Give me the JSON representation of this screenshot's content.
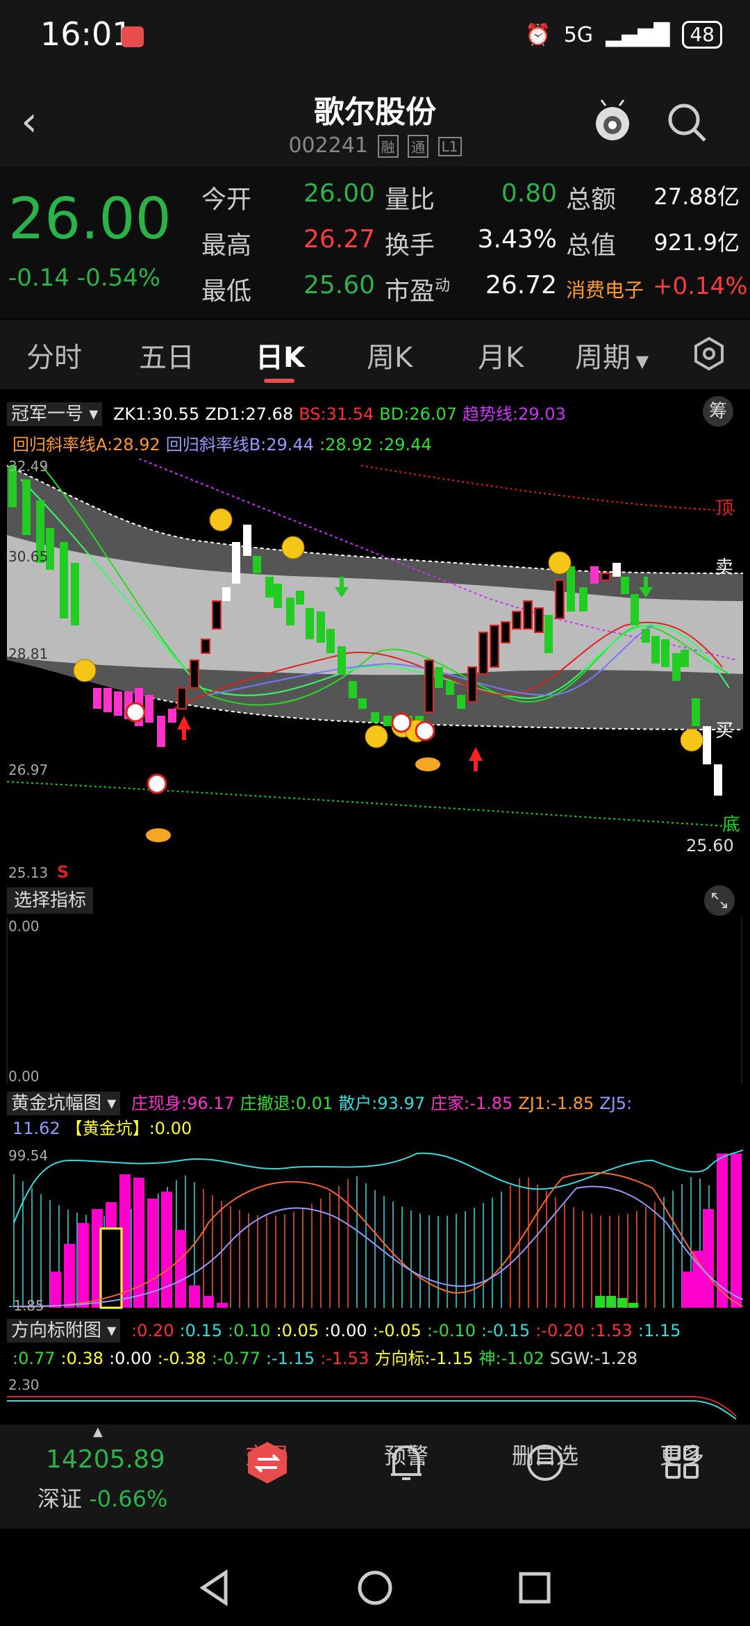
{
  "status": {
    "time": "16:01",
    "network": "5G",
    "battery": "48"
  },
  "header": {
    "name": "歌尔股份",
    "code": "002241",
    "tags": [
      "融",
      "通",
      "L1"
    ]
  },
  "quote": {
    "price": "26.00",
    "change": "-0.14",
    "change_pct": "-0.54%",
    "rows": [
      {
        "l1": "今开",
        "v1": "26.00",
        "l2": "量比",
        "v2": "0.80",
        "l3": "总额",
        "v3": "27.88亿"
      },
      {
        "l1": "最高",
        "v1": "26.27",
        "l2": "换手",
        "v2": "3.43%",
        "l3": "总值",
        "v3": "921.9亿"
      },
      {
        "l1": "最低",
        "v1": "25.60",
        "l2": "市盈",
        "l2sup": "动",
        "v2": "26.72",
        "l3": "消费电子",
        "v3": "+0.14%"
      }
    ]
  },
  "tabs": [
    "分时",
    "五日",
    "日K",
    "周K",
    "月K",
    "周期"
  ],
  "main_indicator": {
    "selector": "冠军一号",
    "line1": [
      {
        "t": "ZK1:30.55",
        "c": "#ffffff"
      },
      {
        "t": "ZD1:27.68",
        "c": "#ffffff"
      },
      {
        "t": "BS:31.54",
        "c": "#ff3030"
      },
      {
        "t": "BD:26.07",
        "c": "#33dd33"
      },
      {
        "t": "趋势线:29.03",
        "c": "#cc33ff"
      }
    ],
    "line2": [
      {
        "t": "回归斜率线A:28.92",
        "c": "#ff9933"
      },
      {
        "t": "回归斜率线B:29.44",
        "c": "#9999ff"
      },
      {
        "t": ":28.92",
        "c": "#33dd33"
      },
      {
        "t": ":29.44",
        "c": "#33dd33"
      }
    ],
    "chou_label": "筹",
    "axis": {
      "top": "32.49",
      "mid1": "30.65",
      "mid2": "28.81",
      "low": "26.97",
      "bottom": "25.13"
    },
    "labels": {
      "top_mark": "顶",
      "sell": "卖",
      "buy": "买",
      "bottom_mark": "底",
      "s_mark": "S",
      "last_price": "25.60"
    }
  },
  "sub1": {
    "selector": "选择指标",
    "top": "0.00",
    "bottom": "0.00"
  },
  "sub2": {
    "selector": "黄金坑幅图",
    "items": [
      {
        "t": "庄现身:96.17",
        "c": "#ff33cc"
      },
      {
        "t": "庄撤退:0.01",
        "c": "#33dd33"
      },
      {
        "t": "散户:93.97",
        "c": "#33dddd"
      },
      {
        "t": "庄家:-1.85",
        "c": "#ff33cc"
      },
      {
        "t": "ZJ1:-1.85",
        "c": "#ff9933"
      },
      {
        "t": "ZJ5:",
        "c": "#9999ff"
      }
    ],
    "line2": [
      {
        "t": "11.62",
        "c": "#9999ff"
      },
      {
        "t": "【黄金坑】:0.00",
        "c": "#ffff33"
      }
    ],
    "top": "99.54",
    "bottom": "-1.85"
  },
  "sub3": {
    "selector": "方向标附图",
    "line1": [
      {
        "t": ":0.20",
        "c": "#ff3030"
      },
      {
        "t": ":0.15",
        "c": "#33dddd"
      },
      {
        "t": ":0.10",
        "c": "#33dd33"
      },
      {
        "t": ":0.05",
        "c": "#ffff33"
      },
      {
        "t": ":0.00",
        "c": "#ffffff"
      },
      {
        "t": ":-0.05",
        "c": "#ffff33"
      },
      {
        "t": ":-0.10",
        "c": "#33dd33"
      },
      {
        "t": ":-0.15",
        "c": "#33dddd"
      },
      {
        "t": ":-0.20",
        "c": "#ff3030"
      },
      {
        "t": ":1.53",
        "c": "#ff3030"
      },
      {
        "t": ":1.15",
        "c": "#33dddd"
      }
    ],
    "line2": [
      {
        "t": ":0.77",
        "c": "#33dd33"
      },
      {
        "t": ":0.38",
        "c": "#ffff33"
      },
      {
        "t": ":0.00",
        "c": "#ffffff"
      },
      {
        "t": ":-0.38",
        "c": "#ffff33"
      },
      {
        "t": ":-0.77",
        "c": "#33dd33"
      },
      {
        "t": ":-1.15",
        "c": "#33dddd"
      },
      {
        "t": ":-1.53",
        "c": "#ff3030"
      },
      {
        "t": "方向标:-1.15",
        "c": "#ffff33"
      },
      {
        "t": "神:-1.02",
        "c": "#33dd33"
      },
      {
        "t": "SGW:-1.28",
        "c": "#dddddd"
      }
    ],
    "top": "2.30"
  },
  "bottom_bar": {
    "index_value": "14205.89",
    "index_name": "深证",
    "index_change": "-0.66%",
    "nav": [
      "交易",
      "预警",
      "删自选",
      "更多"
    ]
  }
}
